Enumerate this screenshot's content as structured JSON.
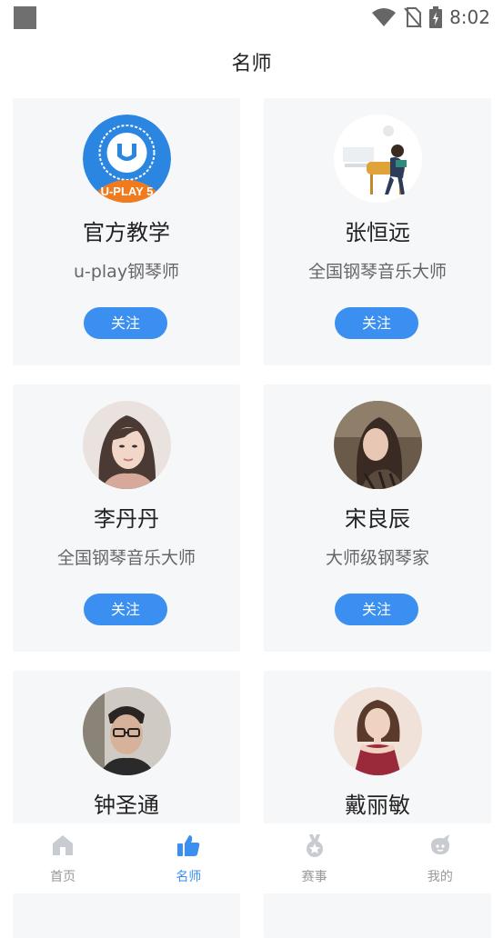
{
  "status_bar": {
    "time": "8:02"
  },
  "header": {
    "title": "名师"
  },
  "teachers": [
    {
      "name": "官方教学",
      "title": "u-play钢琴师",
      "follow_label": "关注",
      "logo_text": "U-PLAY 5"
    },
    {
      "name": "张恒远",
      "title": "全国钢琴音乐大师",
      "follow_label": "关注"
    },
    {
      "name": "李丹丹",
      "title": "全国钢琴音乐大师",
      "follow_label": "关注"
    },
    {
      "name": "宋良辰",
      "title": "大师级钢琴家",
      "follow_label": "关注"
    },
    {
      "name": "钟圣通",
      "title": "",
      "follow_label": ""
    },
    {
      "name": "戴丽敏",
      "title": "",
      "follow_label": ""
    }
  ],
  "bottom_nav": [
    {
      "label": "首页",
      "icon": "home-icon",
      "active": false
    },
    {
      "label": "名师",
      "icon": "thumbs-up-icon",
      "active": true
    },
    {
      "label": "赛事",
      "icon": "medal-icon",
      "active": false
    },
    {
      "label": "我的",
      "icon": "profile-icon",
      "active": false
    }
  ],
  "colors": {
    "accent": "#3a8ff0",
    "card_bg": "#f6f7f9",
    "inactive": "#999999"
  }
}
